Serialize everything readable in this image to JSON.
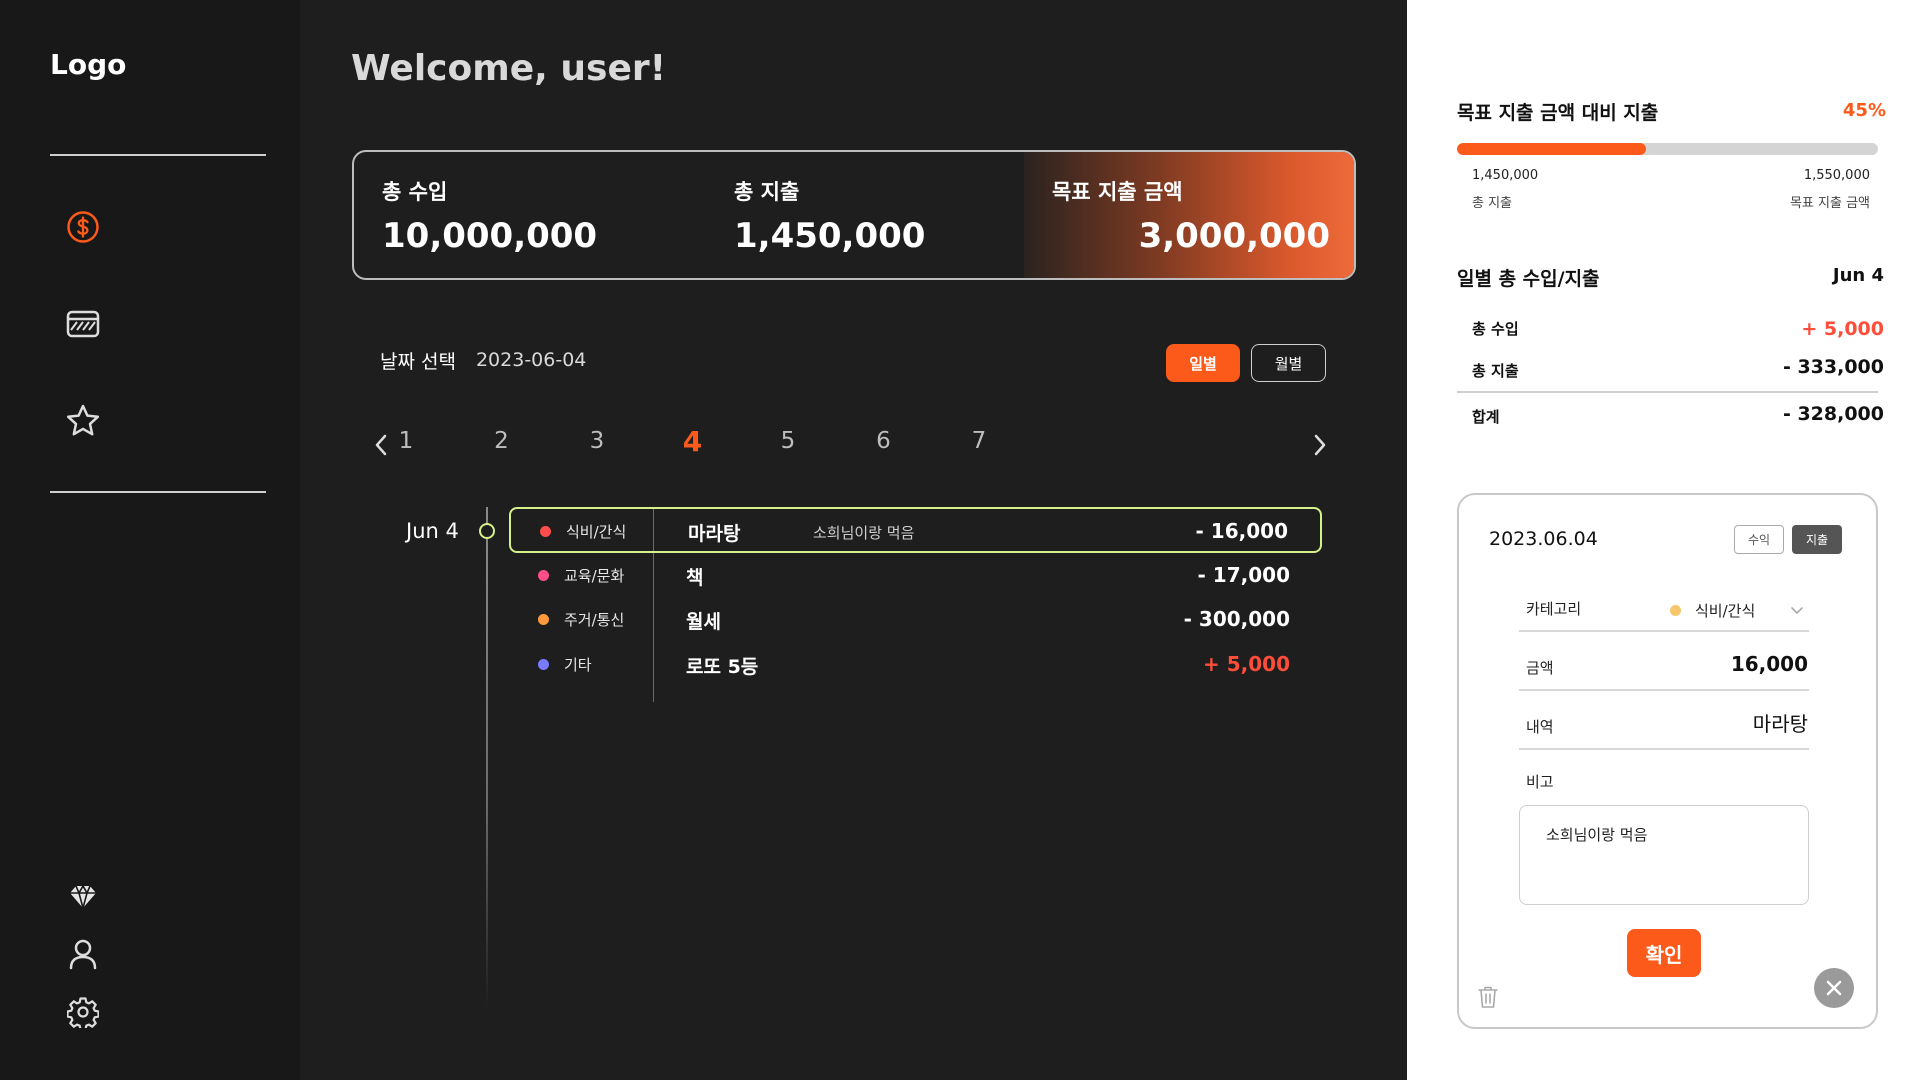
{
  "sidebar": {
    "logo": "Logo"
  },
  "header": {
    "welcome": "Welcome, user!"
  },
  "summary": {
    "income_label": "총 수입",
    "income_value": "10,000,000",
    "expense_label": "총 지출",
    "expense_value": "1,450,000",
    "goal_label": "목표 지출 금액",
    "goal_value": "3,000,000"
  },
  "date_select": {
    "label": "날짜 선택",
    "value": "2023-06-04",
    "daily_label": "일별",
    "monthly_label": "월별"
  },
  "days": [
    "1",
    "2",
    "3",
    "4",
    "5",
    "6",
    "7"
  ],
  "active_day": "4",
  "timeline": {
    "date": "Jun 4",
    "transactions": [
      {
        "category": "식비/간식",
        "dot_color": "#ff4d4d",
        "title": "마라탕",
        "memo": "소희님이랑 먹음",
        "amount": "- 16,000",
        "income": false,
        "selected": true
      },
      {
        "category": "교육/문화",
        "dot_color": "#ff4d8a",
        "title": "책",
        "memo": "",
        "amount": "- 17,000",
        "income": false,
        "selected": false
      },
      {
        "category": "주거/통신",
        "dot_color": "#ff9a3c",
        "title": "월세",
        "memo": "",
        "amount": "- 300,000",
        "income": false,
        "selected": false
      },
      {
        "category": "기타",
        "dot_color": "#7a7aff",
        "title": "로또 5등",
        "memo": "",
        "amount": "+ 5,000",
        "income": true,
        "selected": false
      }
    ]
  },
  "goal_progress": {
    "title": "목표 지출 금액 대비 지출",
    "percent_text": "45%",
    "percent": 0.45,
    "left_value": "1,450,000",
    "left_label": "총 지출",
    "right_value": "1,550,000",
    "right_label": "목표 지출 금액"
  },
  "daily_summary": {
    "title": "일별 총 수입/지출",
    "date": "Jun 4",
    "income_label": "총 수입",
    "income_value": "+ 5,000",
    "expense_label": "총 지출",
    "expense_value": "- 333,000",
    "total_label": "합계",
    "total_value": "- 328,000"
  },
  "edit_card": {
    "date": "2023.06.04",
    "tag_income": "수익",
    "tag_expense": "지출",
    "category_label": "카테고리",
    "category_value": "식비/간식",
    "amount_label": "금액",
    "amount_value": "16,000",
    "detail_label": "내역",
    "detail_value": "마라탕",
    "note_label": "비고",
    "note_value": "소희님이랑 먹음",
    "confirm_label": "확인"
  },
  "colors": {
    "accent": "#fb5a1a",
    "income_red": "#ff4d3a",
    "highlight": "#d6f08a"
  }
}
